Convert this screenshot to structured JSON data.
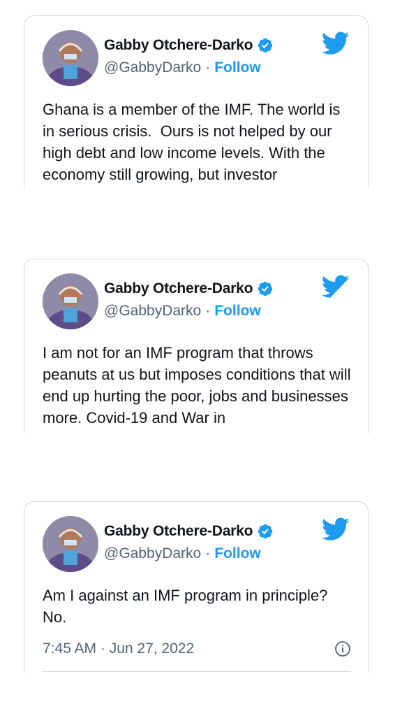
{
  "tweets": [
    {
      "name": "Gabby Otchere-Darko",
      "handle": "@GabbyDarko",
      "separator": "·",
      "follow": "Follow",
      "text": "Ghana is a member of the IMF. The world is in serious crisis.  Ours is not helped by our high debt and low income levels. With the economy still growing, but investor"
    },
    {
      "name": "Gabby Otchere-Darko",
      "handle": "@GabbyDarko",
      "separator": "·",
      "follow": "Follow",
      "text": "I am not for an IMF program that throws peanuts at us but imposes conditions that will end up hurting the poor, jobs and businesses more. Covid-19 and War in"
    },
    {
      "name": "Gabby Otchere-Darko",
      "handle": "@GabbyDarko",
      "separator": "·",
      "follow": "Follow",
      "text": "Am I against an IMF program in principle? No.",
      "timestamp": "7:45 AM · Jun 27, 2022"
    }
  ],
  "icons": {
    "verified": "verified-badge-icon",
    "bird": "twitter-bird-icon",
    "info": "info-icon"
  },
  "colors": {
    "accent": "#1d9bf0",
    "muted": "#536471",
    "border": "#cfd9de"
  }
}
